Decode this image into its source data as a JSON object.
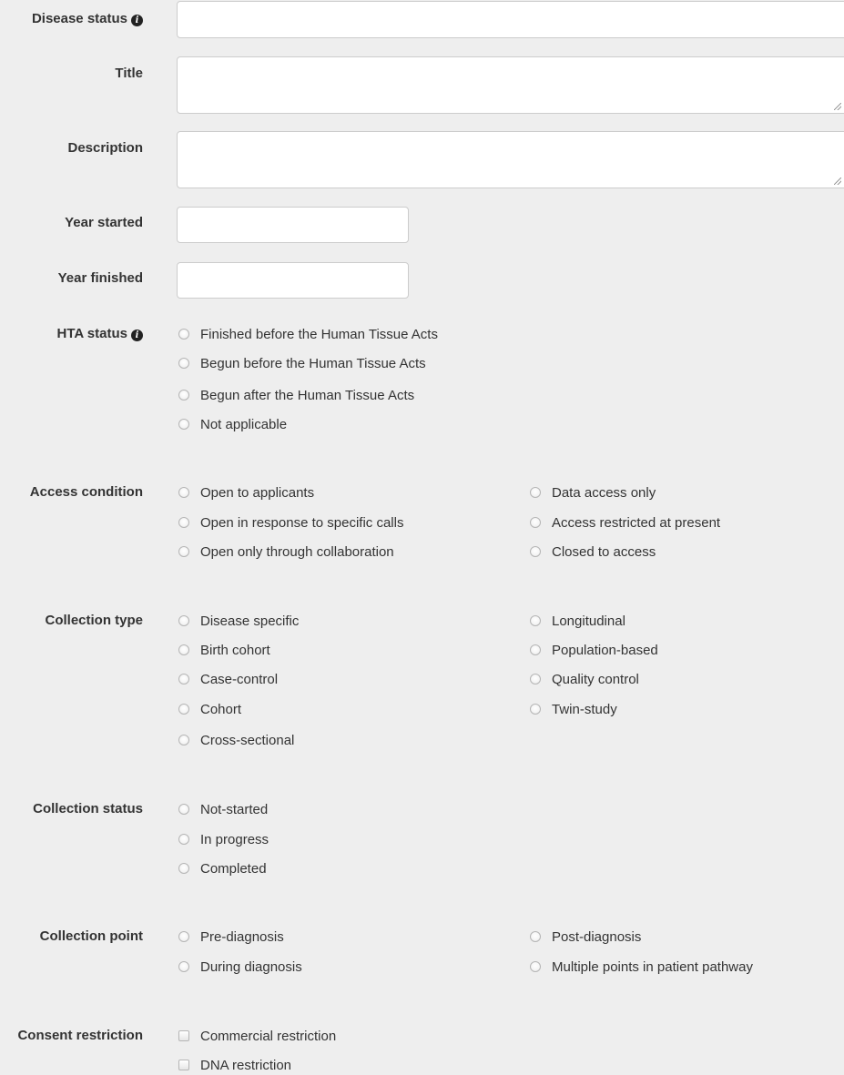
{
  "fields": {
    "disease_status": {
      "label": "Disease status",
      "value": ""
    },
    "title": {
      "label": "Title",
      "value": ""
    },
    "description": {
      "label": "Description",
      "value": ""
    },
    "year_started": {
      "label": "Year started",
      "value": ""
    },
    "year_finished": {
      "label": "Year finished",
      "value": ""
    }
  },
  "hta_status": {
    "label": "HTA status",
    "options": [
      "Finished before the Human Tissue Acts",
      "Begun before the Human Tissue Acts",
      "Begun after the Human Tissue Acts",
      "Not applicable"
    ]
  },
  "access_condition": {
    "label": "Access condition",
    "options": [
      "Open to applicants",
      "Open in response to specific calls",
      "Open only through collaboration",
      "Data access only",
      "Access restricted at present",
      "Closed to access"
    ]
  },
  "collection_type": {
    "label": "Collection type",
    "options": [
      "Disease specific",
      "Birth cohort",
      "Case-control",
      "Cohort",
      "Cross-sectional",
      "Longitudinal",
      "Population-based",
      "Quality control",
      "Twin-study"
    ]
  },
  "collection_status": {
    "label": "Collection status",
    "options": [
      "Not-started",
      "In progress",
      "Completed"
    ]
  },
  "collection_point": {
    "label": "Collection point",
    "options": [
      "Pre-diagnosis",
      "During diagnosis",
      "Post-diagnosis",
      "Multiple points in patient pathway"
    ]
  },
  "consent_restriction": {
    "label": "Consent restriction",
    "options": [
      "Commercial restriction",
      "DNA restriction"
    ]
  },
  "colors": {
    "background": "#eeeeee",
    "text": "#333333",
    "input_border": "#cccccc"
  },
  "icons": {
    "info": "info-circle-icon"
  }
}
